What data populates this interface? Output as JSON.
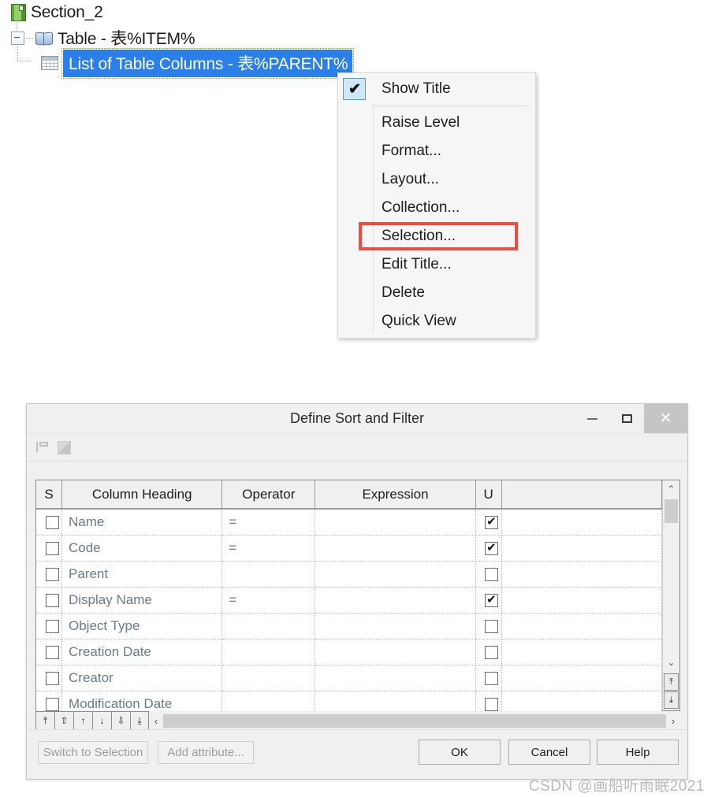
{
  "tree": {
    "nodes": [
      {
        "label": "Section_2",
        "icon": "section-book-icon",
        "selected": false,
        "level": 0
      },
      {
        "label": "Table - 表%ITEM%",
        "icon": "open-book-icon",
        "selected": false,
        "level": 1
      },
      {
        "label": "List of Table Columns - 表%PARENT%",
        "icon": "table-grid-icon",
        "selected": true,
        "level": 2
      }
    ]
  },
  "context_menu": {
    "items": [
      {
        "label": "Show Title",
        "checked": true,
        "highlighted": false
      },
      {
        "label": "Raise Level",
        "checked": false,
        "highlighted": false
      },
      {
        "label": "Format...",
        "checked": false,
        "highlighted": false
      },
      {
        "label": "Layout...",
        "checked": false,
        "highlighted": false
      },
      {
        "label": "Collection...",
        "checked": false,
        "highlighted": false
      },
      {
        "label": "Selection...",
        "checked": false,
        "highlighted": true
      },
      {
        "label": "Edit Title...",
        "checked": false,
        "highlighted": false
      },
      {
        "label": "Delete",
        "checked": false,
        "highlighted": false
      },
      {
        "label": "Quick View",
        "checked": false,
        "highlighted": false
      }
    ],
    "checkmark_glyph": "✔",
    "highlight_color": "#ef4b40"
  },
  "dialog": {
    "title": "Define Sort and Filter",
    "window_buttons": {
      "minimize": "–",
      "maximize": "□",
      "close": "✕"
    },
    "toolbar_icons": [
      "branch-tree-icon",
      "page-icon"
    ],
    "grid": {
      "columns": [
        "S",
        "Column Heading",
        "Operator",
        "Expression",
        "U",
        ""
      ],
      "rows": [
        {
          "s": false,
          "heading": "Name",
          "operator": "=",
          "expression": "",
          "u": true
        },
        {
          "s": false,
          "heading": "Code",
          "operator": "=",
          "expression": "",
          "u": true
        },
        {
          "s": false,
          "heading": "Parent",
          "operator": "",
          "expression": "",
          "u": false
        },
        {
          "s": false,
          "heading": "Display Name",
          "operator": "=",
          "expression": "",
          "u": true
        },
        {
          "s": false,
          "heading": "Object Type",
          "operator": "",
          "expression": "",
          "u": false
        },
        {
          "s": false,
          "heading": "Creation Date",
          "operator": "",
          "expression": "",
          "u": false
        },
        {
          "s": false,
          "heading": "Creator",
          "operator": "",
          "expression": "",
          "u": false
        },
        {
          "s": false,
          "heading": "Modification Date",
          "operator": "",
          "expression": "",
          "u": false
        }
      ]
    },
    "sort_buttons": [
      {
        "name": "move-to-top",
        "glyph": "⤒"
      },
      {
        "name": "move-up-fast",
        "glyph": "⇧"
      },
      {
        "name": "move-up",
        "glyph": "↑"
      },
      {
        "name": "move-down",
        "glyph": "↓"
      },
      {
        "name": "move-down-fast",
        "glyph": "⇩"
      },
      {
        "name": "move-to-bottom",
        "glyph": "⤓"
      }
    ],
    "scroll": {
      "up_glyph": "⌃",
      "down_glyph": "⌄",
      "top_glyph": "⤒",
      "bottom_glyph": "⤓",
      "left_glyph": "‹",
      "right_glyph": "›"
    },
    "buttons": {
      "switch_to_selection": "Switch to Selection",
      "add_attribute": "Add attribute...",
      "ok": "OK",
      "cancel": "Cancel",
      "help": "Help"
    }
  },
  "watermark": "CSDN @画船听雨眠2021"
}
